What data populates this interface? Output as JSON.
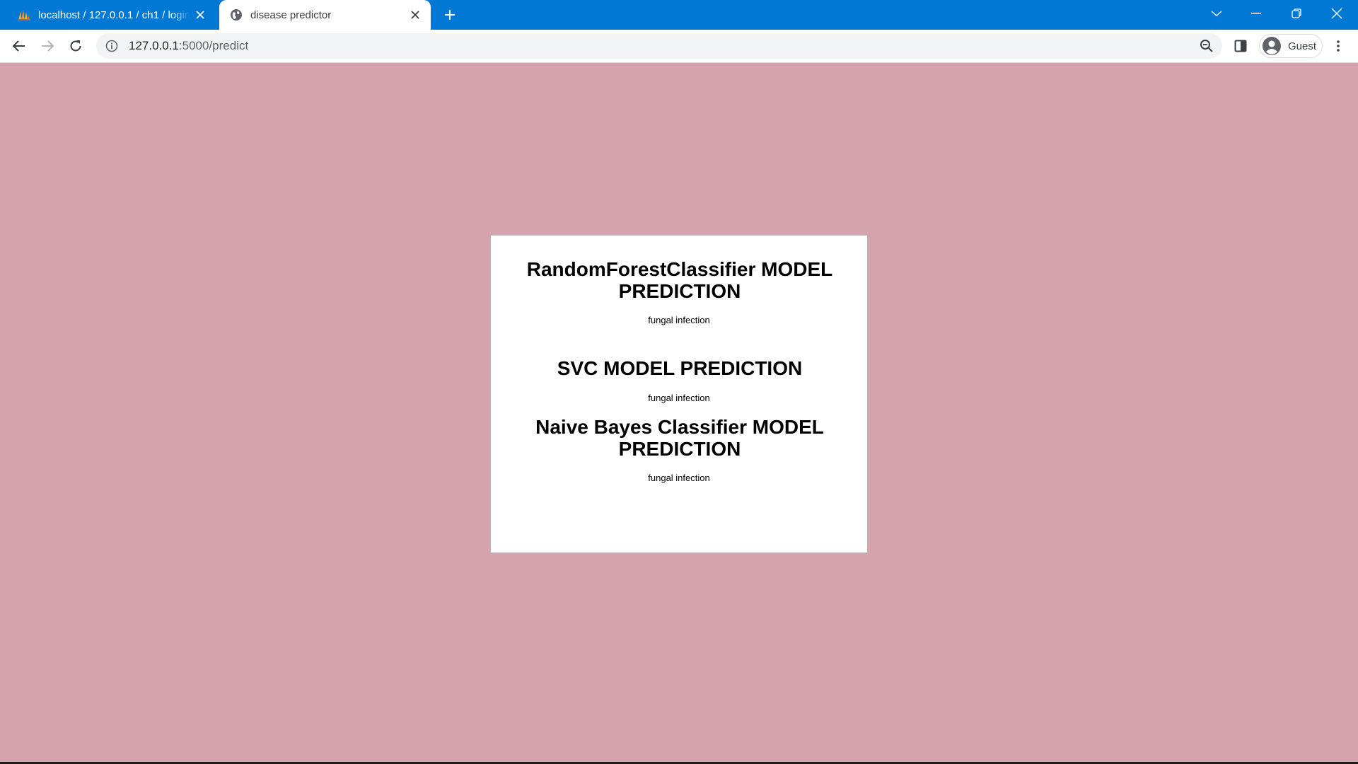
{
  "browser": {
    "tabs": [
      {
        "title": "localhost / 127.0.0.1 / ch1 / login",
        "icon": "phpmyadmin-icon",
        "active": false
      },
      {
        "title": "disease predictor",
        "icon": "globe-icon",
        "active": true
      }
    ],
    "address": {
      "host": "127.0.0.1",
      "path": ":5000/predict"
    },
    "profile_label": "Guest",
    "accent_color": "#0078d4"
  },
  "page": {
    "background_color": "#d4a3ae",
    "predictions": [
      {
        "heading": "RandomForestClassifier MODEL PREDICTION",
        "result": "fungal infection"
      },
      {
        "heading": "SVC MODEL PREDICTION",
        "result": "fungal infection"
      },
      {
        "heading": "Naive Bayes Classifier MODEL PREDICTION",
        "result": "fungal infection"
      }
    ]
  }
}
